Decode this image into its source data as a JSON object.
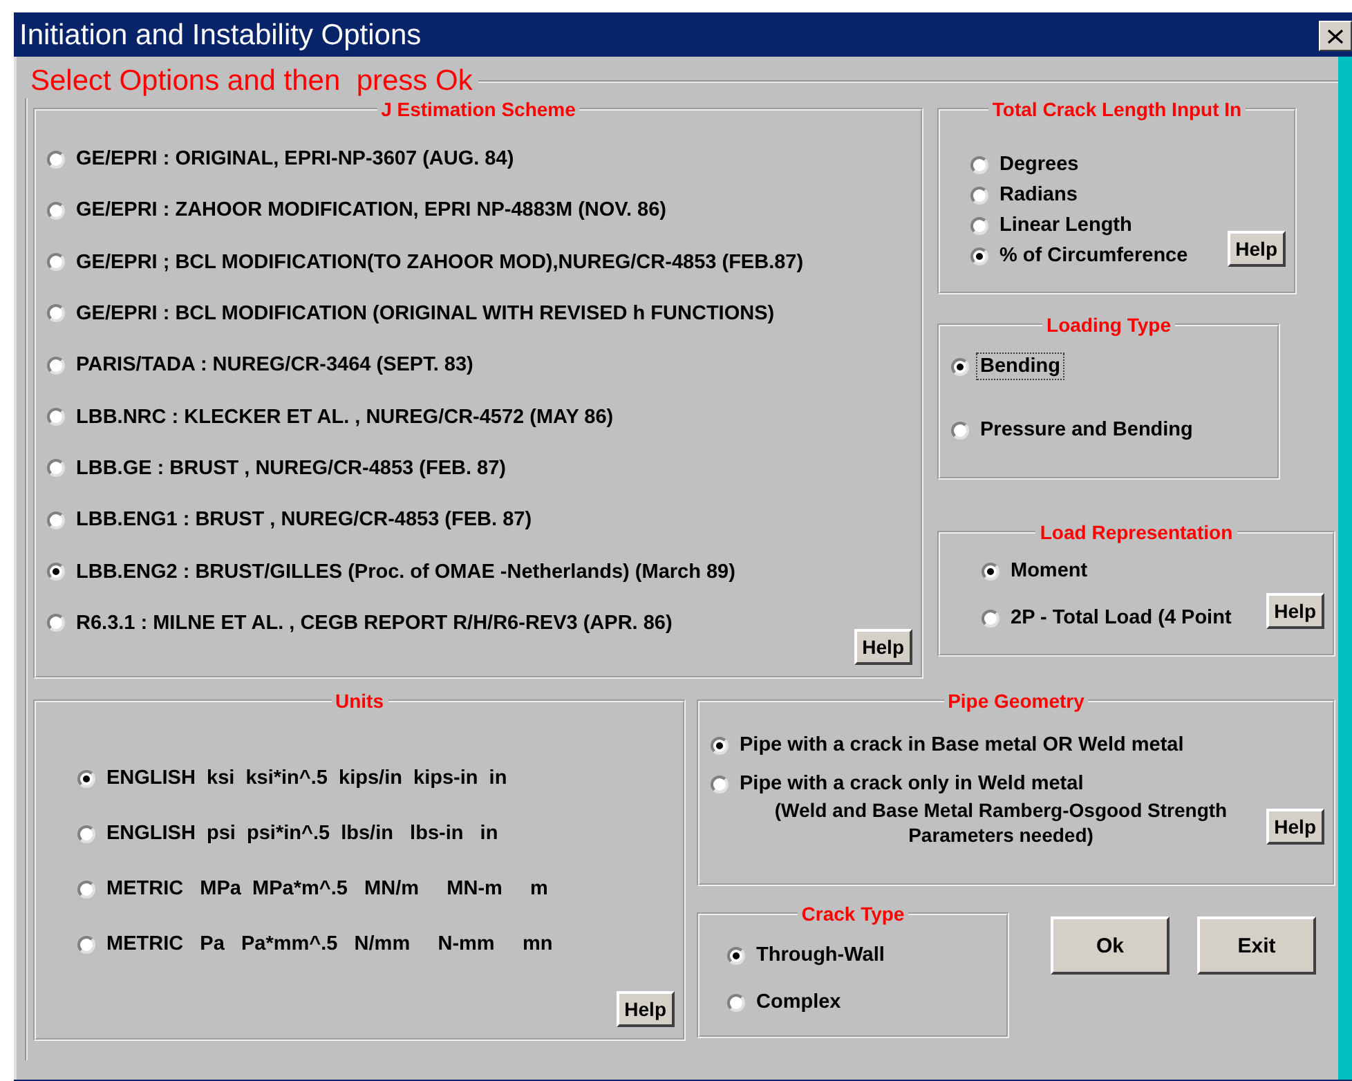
{
  "window": {
    "title": "Initiation and Instability Options"
  },
  "prompt": "Select Options and then  press Ok",
  "j_scheme": {
    "title": "J Estimation Scheme",
    "help": "Help",
    "options": [
      {
        "label": "GE/EPRI : ORIGINAL, EPRI-NP-3607 (AUG. 84)",
        "selected": false
      },
      {
        "label": "GE/EPRI : ZAHOOR MODIFICATION, EPRI NP-4883M (NOV. 86)",
        "selected": false
      },
      {
        "label": "GE/EPRI ; BCL MODIFICATION(TO ZAHOOR MOD),NUREG/CR-4853 (FEB.87)",
        "selected": false
      },
      {
        "label": "GE/EPRI : BCL MODIFICATION (ORIGINAL WITH REVISED h FUNCTIONS)",
        "selected": false
      },
      {
        "label": "PARIS/TADA : NUREG/CR-3464 (SEPT. 83)",
        "selected": false
      },
      {
        "label": "LBB.NRC : KLECKER ET AL. , NUREG/CR-4572 (MAY 86)",
        "selected": false
      },
      {
        "label": "LBB.GE : BRUST , NUREG/CR-4853 (FEB. 87)",
        "selected": false
      },
      {
        "label": "LBB.ENG1 : BRUST , NUREG/CR-4853 (FEB. 87)",
        "selected": false
      },
      {
        "label": "LBB.ENG2 : BRUST/GILLES (Proc. of OMAE -Netherlands) (March 89)",
        "selected": true
      },
      {
        "label": "R6.3.1 : MILNE ET AL. , CEGB REPORT R/H/R6-REV3 (APR. 86)",
        "selected": false
      }
    ]
  },
  "crack_length_input": {
    "title": "Total Crack Length Input In",
    "help": "Help",
    "options": [
      {
        "label": "Degrees",
        "selected": false
      },
      {
        "label": "Radians",
        "selected": false
      },
      {
        "label": "Linear Length",
        "selected": false
      },
      {
        "label": "% of Circumference",
        "selected": true
      }
    ]
  },
  "loading_type": {
    "title": "Loading Type",
    "options": [
      {
        "label": "Bending",
        "selected": true,
        "focused": true
      },
      {
        "label": "Pressure and Bending",
        "selected": false,
        "focused": false
      }
    ]
  },
  "load_representation": {
    "title": "Load Representation",
    "help": "Help",
    "options": [
      {
        "label": "Moment",
        "selected": true
      },
      {
        "label": "2P - Total Load (4 Point",
        "selected": false
      }
    ]
  },
  "units": {
    "title": "Units",
    "help": "Help",
    "options": [
      {
        "label": "ENGLISH  ksi  ksi*in^.5  kips/in  kips-in  in",
        "selected": true
      },
      {
        "label": "ENGLISH  psi  psi*in^.5  lbs/in   lbs-in   in",
        "selected": false
      },
      {
        "label": "METRIC   MPa  MPa*m^.5   MN/m     MN-m     m",
        "selected": false
      },
      {
        "label": "METRIC   Pa   Pa*mm^.5   N/mm     N-mm     mn",
        "selected": false
      }
    ]
  },
  "pipe_geometry": {
    "title": "Pipe Geometry",
    "help": "Help",
    "note": "(Weld and Base Metal Ramberg-Osgood Strength Parameters needed)",
    "options": [
      {
        "label": "Pipe with a crack in Base metal OR Weld metal",
        "selected": true
      },
      {
        "label": "Pipe with a crack only in Weld metal",
        "selected": false
      }
    ]
  },
  "crack_type": {
    "title": "Crack Type",
    "options": [
      {
        "label": "Through-Wall",
        "selected": true
      },
      {
        "label": "Complex",
        "selected": false
      }
    ]
  },
  "buttons": [
    "Ok",
    "Exit"
  ]
}
